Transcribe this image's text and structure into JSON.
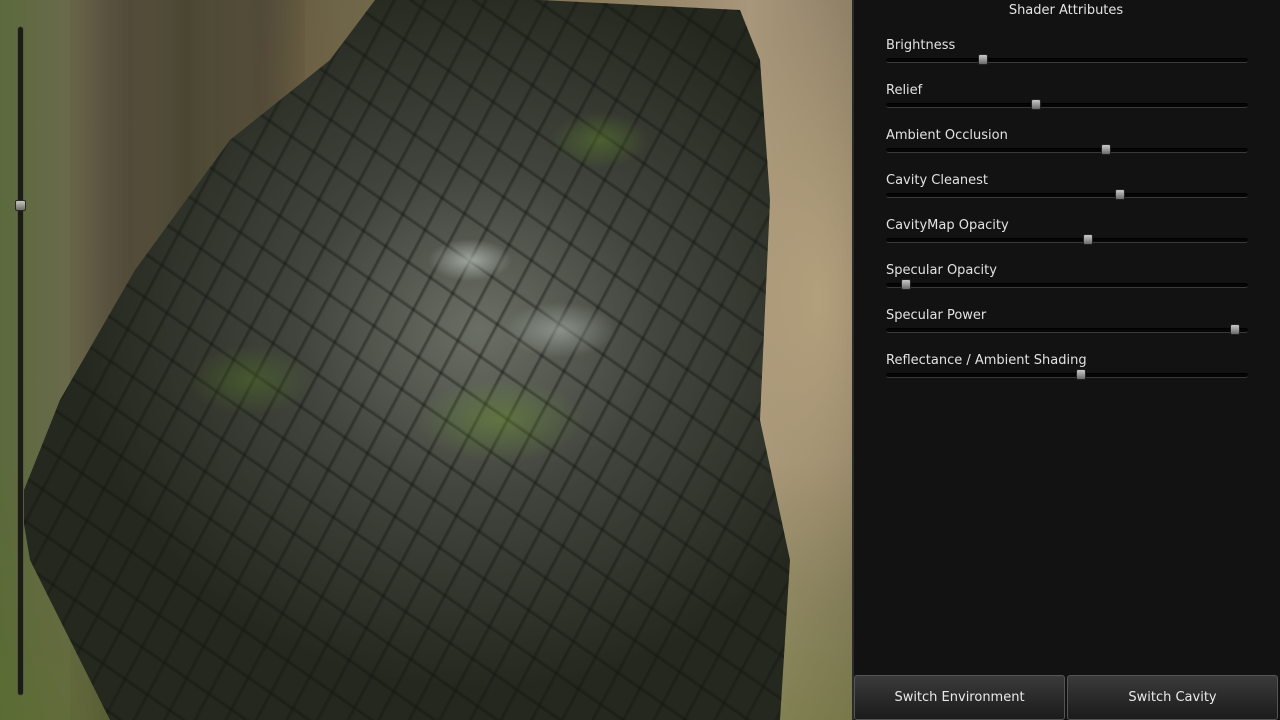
{
  "panel": {
    "title": "Shader Attributes",
    "attributes": [
      {
        "label": "Brightness",
        "value": 0.26
      },
      {
        "label": "Relief",
        "value": 0.41
      },
      {
        "label": "Ambient Occlusion",
        "value": 0.61
      },
      {
        "label": "Cavity Cleanest",
        "value": 0.65
      },
      {
        "label": "CavityMap Opacity",
        "value": 0.56
      },
      {
        "label": "Specular Opacity",
        "value": 0.04
      },
      {
        "label": "Specular Power",
        "value": 0.98
      },
      {
        "label": "Reflectance / Ambient Shading",
        "value": 0.54
      }
    ]
  },
  "view_slider": {
    "value": 0.27
  },
  "buttons": {
    "switch_environment": "Switch Environment",
    "switch_cavity": "Switch Cavity"
  },
  "colors": {
    "panel_background": "#121212",
    "text": "#e2e2e2",
    "moss_green": "#7aa92a"
  }
}
